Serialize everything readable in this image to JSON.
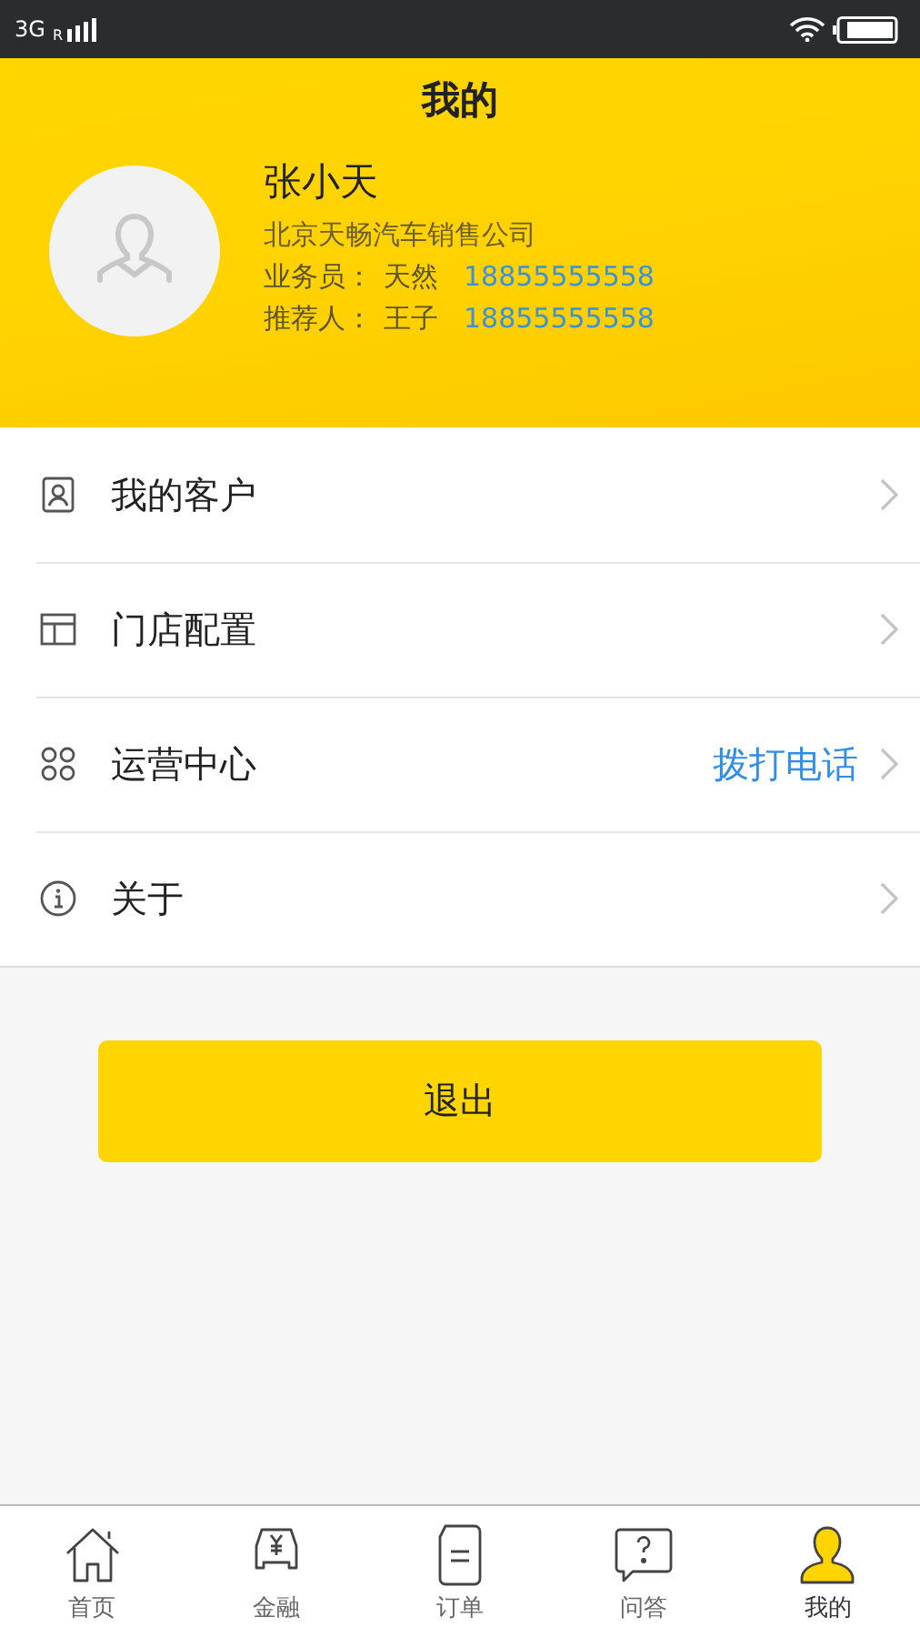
{
  "status_bar": {
    "network": "3G",
    "roaming": "R"
  },
  "header": {
    "title": "我的"
  },
  "profile": {
    "name": "张小天",
    "company": "北京天畅汽车销售公司",
    "contacts": [
      {
        "label": "业务员：",
        "person": "天然",
        "phone": "18855555558"
      },
      {
        "label": "推荐人：",
        "person": "王子",
        "phone": "18855555558"
      }
    ]
  },
  "menu": [
    {
      "kind": "contact",
      "label": "我的客户"
    },
    {
      "kind": "store",
      "label": "门店配置"
    },
    {
      "kind": "grid",
      "label": "运营中心",
      "action": "拨打电话"
    },
    {
      "kind": "info",
      "label": "关于"
    }
  ],
  "logout_button": "退出",
  "tab_bar": [
    {
      "kind": "home",
      "label": "首页",
      "selected": false
    },
    {
      "kind": "finance",
      "label": "金融",
      "selected": false
    },
    {
      "kind": "order",
      "label": "订单",
      "selected": false
    },
    {
      "kind": "qa",
      "label": "问答",
      "selected": false
    },
    {
      "kind": "me",
      "label": "我的",
      "selected": true
    }
  ]
}
